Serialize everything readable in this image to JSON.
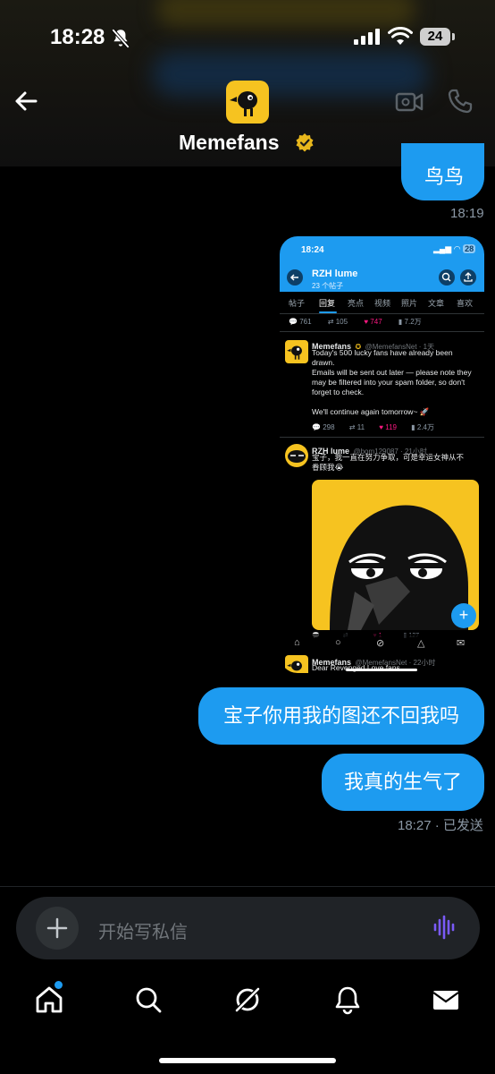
{
  "status_bar": {
    "time": "18:28",
    "battery": "24"
  },
  "header": {
    "contact_name": "Memefans"
  },
  "messages": {
    "top_partial": "鸟鸟",
    "time_1": "18:19",
    "bubble_1": "宝子你用我的图还不回我吗",
    "bubble_2": "我真的生气了",
    "time_2": "18:27 · 已发送"
  },
  "shared_screenshot": {
    "time": "18:24",
    "battery": "28",
    "profile_name": "RZH lume",
    "profile_posts": "23 个帖子",
    "tabs": [
      "帖子",
      "回复",
      "亮点",
      "视频",
      "照片",
      "文章",
      "喜欢"
    ],
    "active_tab": "回复",
    "stats_row_1": {
      "replies": "761",
      "reposts": "105",
      "likes": "747",
      "views": "7.2万"
    },
    "post_1": {
      "name": "Memefans",
      "handle": "@MemefansNet · 1天",
      "line_1": "Today's 500 lucky fans have already been",
      "line_2": "drawn.",
      "line_3": "Emails will be sent out later — please note they",
      "line_4": "may be filtered into your spam folder, so don't",
      "line_5": "forget to check.",
      "line_6": "We'll continue again tomorrow~ 🚀",
      "replies": "298",
      "reposts": "11",
      "likes": "119",
      "views": "2.4万"
    },
    "post_2": {
      "name": "RZH lume",
      "handle": "@bom129087 · 21小时",
      "line_1": "宝子，我一直在努力争取，可是幸运女神从不",
      "line_2": "眷顾我😭",
      "likes": "1",
      "views": "127"
    },
    "post_3": {
      "name": "Memefans",
      "handle": "@MemefansNet · 22小时",
      "line_1": "Dear Revenged Love fans,"
    }
  },
  "composer": {
    "placeholder": "开始写私信"
  },
  "colors": {
    "accent": "#1d9bf0",
    "brand_yellow": "#f6c320",
    "background": "#000000"
  }
}
